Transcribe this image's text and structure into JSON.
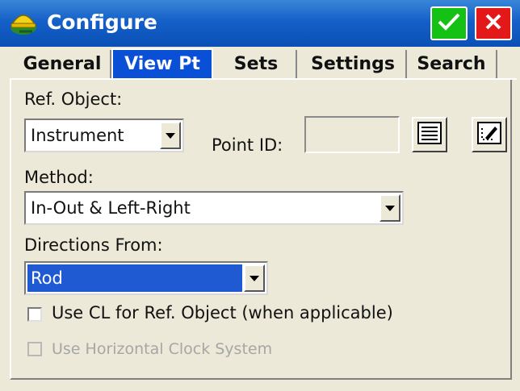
{
  "window": {
    "title": "Configure",
    "app_icon": "survey-helmet-icon"
  },
  "title_buttons": {
    "ok_icon": "checkmark-icon",
    "close_icon": "close-icon"
  },
  "tabs": [
    {
      "label": "General",
      "selected": false
    },
    {
      "label": "View Pt",
      "selected": true
    },
    {
      "label": "Sets",
      "selected": false
    },
    {
      "label": "Settings",
      "selected": false
    },
    {
      "label": "Search",
      "selected": false
    }
  ],
  "form": {
    "ref_object_label": "Ref. Object:",
    "ref_object_value": "Instrument",
    "point_id_label": "Point ID:",
    "point_id_value": "",
    "list_button_icon": "list-icon",
    "map_button_icon": "map-pick-icon",
    "method_label": "Method:",
    "method_value": "In-Out & Left-Right",
    "directions_label": "Directions From:",
    "directions_value": "Rod",
    "use_cl_label": "Use CL for Ref. Object (when applicable)",
    "use_cl_checked": false,
    "use_clock_label": "Use Horizontal Clock System",
    "use_clock_checked": false,
    "use_clock_enabled": false
  },
  "colors": {
    "titlebar": "#1460c8",
    "selected_tab": "#0a50d6",
    "ok_green": "#16c116",
    "close_red": "#e31818",
    "selection_blue": "#1f5ad2"
  }
}
